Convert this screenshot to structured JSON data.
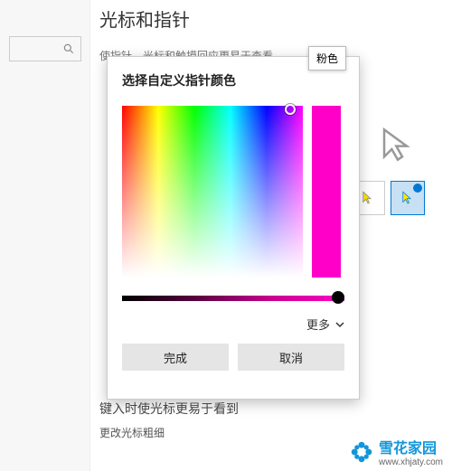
{
  "page": {
    "title": "光标和指针",
    "subtitle": "使指针、光标和触摸回应更易于查看",
    "below_dialog": "键入时使光标更易于看到",
    "thickness_label": "更改光标粗细"
  },
  "tooltip": "粉色",
  "dialog": {
    "title": "选择自定义指针颜色",
    "more": "更多",
    "done": "完成",
    "cancel": "取消",
    "selected_hue_hex": "#ff00c8"
  },
  "watermark": {
    "name": "雪花家园",
    "url": "www.xhjaty.com"
  }
}
